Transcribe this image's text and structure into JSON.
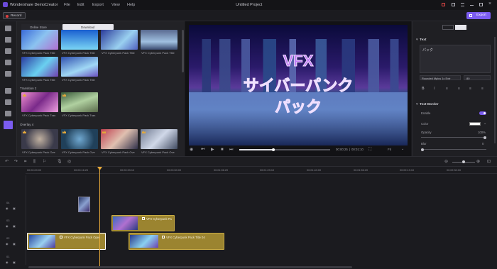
{
  "app": {
    "name": "Wondershare DemoCreator",
    "title": "Untitled Project",
    "accent": "#7b5cf0"
  },
  "menu": [
    "File",
    "Edit",
    "Export",
    "View",
    "Help"
  ],
  "toolbar": {
    "record": "Record",
    "export": "Export"
  },
  "library": {
    "tabs": {
      "online": "Online Store",
      "download": "Download"
    },
    "sections": {
      "transitions": "Transition 2",
      "overlays": "Overlay 4"
    },
    "row1": [
      "VFX Cyberpunk Pack Title",
      "VFX Cyberpunk Pack Title",
      "VFX Cyberpunk Pack Title",
      "VFX Cyberpunk Pack Title"
    ],
    "row2": [
      "VFX Cyberpunk Pack Title",
      "VFX Cyberpunk Pack Title"
    ],
    "row3": [
      "VFX Cyberpunk Pack Tran",
      "VFX Cyberpunk Pack Tran"
    ],
    "row4": [
      "VFX Cyberpunk Pack Ove",
      "VFX Cyberpunk Pack Ove",
      "VFX Cyberpunk Pack Ove",
      "VFX Cyberpunk Pack Ove"
    ]
  },
  "preview": {
    "overlay_lines": [
      "VFX",
      "サイバーパンク",
      "パック"
    ],
    "time_current": "00:00:25",
    "time_total": "00:01:10",
    "speed": "Fit"
  },
  "props": {
    "section_text": "Text",
    "text_value": "パック",
    "font": "Rounded Mplus 1c Extr",
    "size": "80",
    "section_border": "Text Border",
    "enable": "Enable",
    "color": "Color",
    "opacity": "Opacity",
    "opacity_value": "100%",
    "blur": "Blur",
    "blur_value": "0",
    "opacity_level": 1.0,
    "blur_level": 0.0
  },
  "timeline": {
    "ticks": [
      "00:00:00:00",
      "00:00:16:20",
      "00:00:33:10",
      "00:00:50:00",
      "00:01:06:20",
      "00:01:23:10",
      "00:01:40:00",
      "00:01:56:20",
      "00:02:13:10",
      "00:02:30:00"
    ],
    "tracks": [
      "04",
      "03",
      "02",
      "01"
    ],
    "clips": {
      "c1": "VFX Cyberpunk Pack Oper",
      "c2": "VFX Cyberpunk Pack Title 04",
      "c3": "VFX Cyberpunk Pa"
    }
  }
}
